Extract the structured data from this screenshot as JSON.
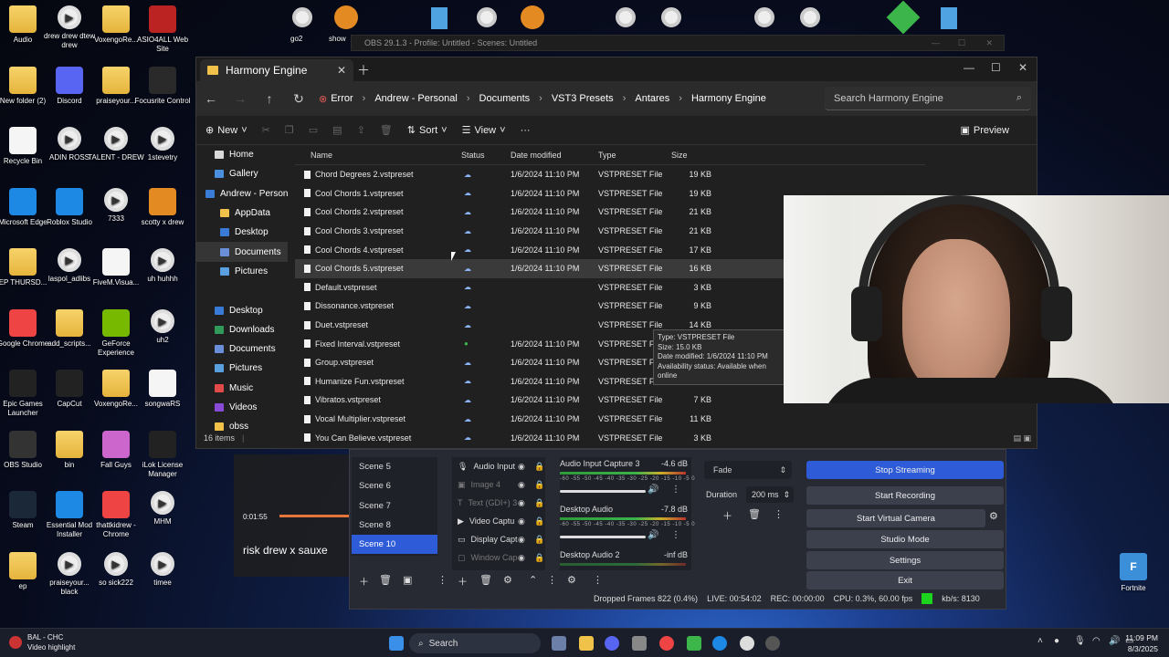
{
  "desktop": {
    "icons": [
      {
        "label": "Audio"
      },
      {
        "label": "drew drew dtew drew"
      },
      {
        "label": "VoxengoRe..."
      },
      {
        "label": "ASIO4ALL Web Site"
      },
      {
        "label": "New folder (2)"
      },
      {
        "label": "Discord"
      },
      {
        "label": "praiseyour..."
      },
      {
        "label": "Focusrite Control"
      },
      {
        "label": "Recycle Bin"
      },
      {
        "label": "ADIN ROSS"
      },
      {
        "label": "TALENT - DREW"
      },
      {
        "label": "1stevetry"
      },
      {
        "label": "Microsoft Edge"
      },
      {
        "label": "Roblox Studio"
      },
      {
        "label": "7333"
      },
      {
        "label": "scotty x drew"
      },
      {
        "label": "EP THURSD..."
      },
      {
        "label": "laspol_adlibs"
      },
      {
        "label": "FiveM.Visua..."
      },
      {
        "label": "uh huhhh"
      },
      {
        "label": "Google Chrome"
      },
      {
        "label": "add_scripts..."
      },
      {
        "label": "GeForce Experience"
      },
      {
        "label": "uh2"
      },
      {
        "label": "Epic Games Launcher"
      },
      {
        "label": "CapCut"
      },
      {
        "label": "VoxengoRe..."
      },
      {
        "label": "songwaRS"
      },
      {
        "label": "OBS Studio"
      },
      {
        "label": "bin"
      },
      {
        "label": "Fall Guys"
      },
      {
        "label": "iLok License Manager"
      },
      {
        "label": "Steam"
      },
      {
        "label": "Essential Mod Installer"
      },
      {
        "label": "thattkidrew - Chrome"
      },
      {
        "label": "MHM"
      },
      {
        "label": "ep"
      },
      {
        "label": "praiseyour... black"
      },
      {
        "label": "so sick222"
      },
      {
        "label": "timee"
      }
    ],
    "top_labels": {
      "go2": "go2",
      "show": "show"
    },
    "fortnite": "Fortnite"
  },
  "explorer": {
    "tab_title": "Harmony Engine",
    "breadcrumb": [
      "Error",
      "Andrew - Personal",
      "Documents",
      "VST3 Presets",
      "Antares",
      "Harmony Engine"
    ],
    "search_placeholder": "Search Harmony Engine",
    "toolbar": {
      "new": "New",
      "sort": "Sort",
      "view": "View",
      "more": "···",
      "preview": "Preview"
    },
    "sidebar": [
      "Home",
      "Gallery",
      "Andrew - Person",
      "AppData",
      "Desktop",
      "Documents",
      "Pictures",
      "",
      "Desktop",
      "Downloads",
      "Documents",
      "Pictures",
      "Music",
      "Videos",
      "obss"
    ],
    "columns": {
      "name": "Name",
      "status": "Status",
      "modified": "Date modified",
      "type": "Type",
      "size": "Size"
    },
    "files": [
      {
        "name": "Chord Degrees 2.vstpreset",
        "modified": "1/6/2024 11:10 PM",
        "type": "VSTPRESET File",
        "size": "19 KB"
      },
      {
        "name": "Cool Chords 1.vstpreset",
        "modified": "1/6/2024 11:10 PM",
        "type": "VSTPRESET File",
        "size": "19 KB"
      },
      {
        "name": "Cool Chords 2.vstpreset",
        "modified": "1/6/2024 11:10 PM",
        "type": "VSTPRESET File",
        "size": "21 KB"
      },
      {
        "name": "Cool Chords 3.vstpreset",
        "modified": "1/6/2024 11:10 PM",
        "type": "VSTPRESET File",
        "size": "21 KB"
      },
      {
        "name": "Cool Chords 4.vstpreset",
        "modified": "1/6/2024 11:10 PM",
        "type": "VSTPRESET File",
        "size": "17 KB"
      },
      {
        "name": "Cool Chords 5.vstpreset",
        "modified": "1/6/2024 11:10 PM",
        "type": "VSTPRESET File",
        "size": "16 KB"
      },
      {
        "name": "Default.vstpreset",
        "modified": "",
        "type": "VSTPRESET File",
        "size": "3 KB"
      },
      {
        "name": "Dissonance.vstpreset",
        "modified": "",
        "type": "VSTPRESET File",
        "size": "9 KB"
      },
      {
        "name": "Duet.vstpreset",
        "modified": "",
        "type": "VSTPRESET File",
        "size": "14 KB"
      },
      {
        "name": "Fixed Interval.vstpreset",
        "modified": "1/6/2024 11:10 PM",
        "type": "VSTPRESET File",
        "size": "6 KB"
      },
      {
        "name": "Group.vstpreset",
        "modified": "1/6/2024 11:10 PM",
        "type": "VSTPRESET File",
        "size": "17 KB"
      },
      {
        "name": "Humanize Fun.vstpreset",
        "modified": "1/6/2024 11:10 PM",
        "type": "VSTPRESET File",
        "size": "22 KB"
      },
      {
        "name": "Vibratos.vstpreset",
        "modified": "1/6/2024 11:10 PM",
        "type": "VSTPRESET File",
        "size": "7 KB"
      },
      {
        "name": "Vocal Multiplier.vstpreset",
        "modified": "1/6/2024 11:10 PM",
        "type": "VSTPRESET File",
        "size": "11 KB"
      },
      {
        "name": "You Can Believe.vstpreset",
        "modified": "1/6/2024 11:10 PM",
        "type": "VSTPRESET File",
        "size": "3 KB"
      }
    ],
    "tooltip": {
      "type": "Type: VSTPRESET File",
      "size": "Size: 15.0 KB",
      "modified": "Date modified: 1/6/2024 11:10 PM",
      "availability": "Availability status: Available when online"
    },
    "status": "16 items"
  },
  "obs": {
    "title": "OBS 29.1.3 - Profile: Untitled - Scenes: Untitled",
    "scenes": [
      "Scene 5",
      "Scene 6",
      "Scene 7",
      "Scene 8",
      "Scene 10"
    ],
    "sources": [
      {
        "label": "Audio Input"
      },
      {
        "label": "Image 4"
      },
      {
        "label": "Text (GDI+) 3"
      },
      {
        "label": "Video Captu"
      },
      {
        "label": "Display Capt"
      },
      {
        "label": "Window Cap"
      }
    ],
    "mixer": [
      {
        "name": "Audio Input Capture 3",
        "db": "-4.6 dB"
      },
      {
        "name": "Desktop Audio",
        "db": "-7.8 dB"
      },
      {
        "name": "Desktop Audio 2",
        "db": "-inf dB"
      }
    ],
    "meter_scale": "-60 -55 -50 -45 -40 -35 -30 -25 -20 -15 -10 -5 0",
    "transition": {
      "type": "Fade",
      "duration_label": "Duration",
      "duration": "200 ms"
    },
    "controls": [
      "Stop Streaming",
      "Start Recording",
      "Start Virtual Camera",
      "Studio Mode",
      "Settings",
      "Exit"
    ],
    "status": {
      "dropped": "Dropped Frames 822 (0.4%)",
      "live": "LIVE: 00:54:02",
      "rec": "REC: 00:00:00",
      "cpu": "CPU: 0.3%, 60.00 fps",
      "kbs": "kb/s: 8130"
    }
  },
  "overlay": {
    "time": "0:01:55",
    "caption": "risk drew x sauxe"
  },
  "taskbar": {
    "notif_line1": "BAL - CHC",
    "notif_line2": "Video highlight",
    "search": "Search",
    "time": "11:09 PM",
    "date": "8/3/2025"
  },
  "colors": {
    "accent": "#2e5cd8",
    "folder": "#f0c24a",
    "live_green": "#1ed31e"
  }
}
